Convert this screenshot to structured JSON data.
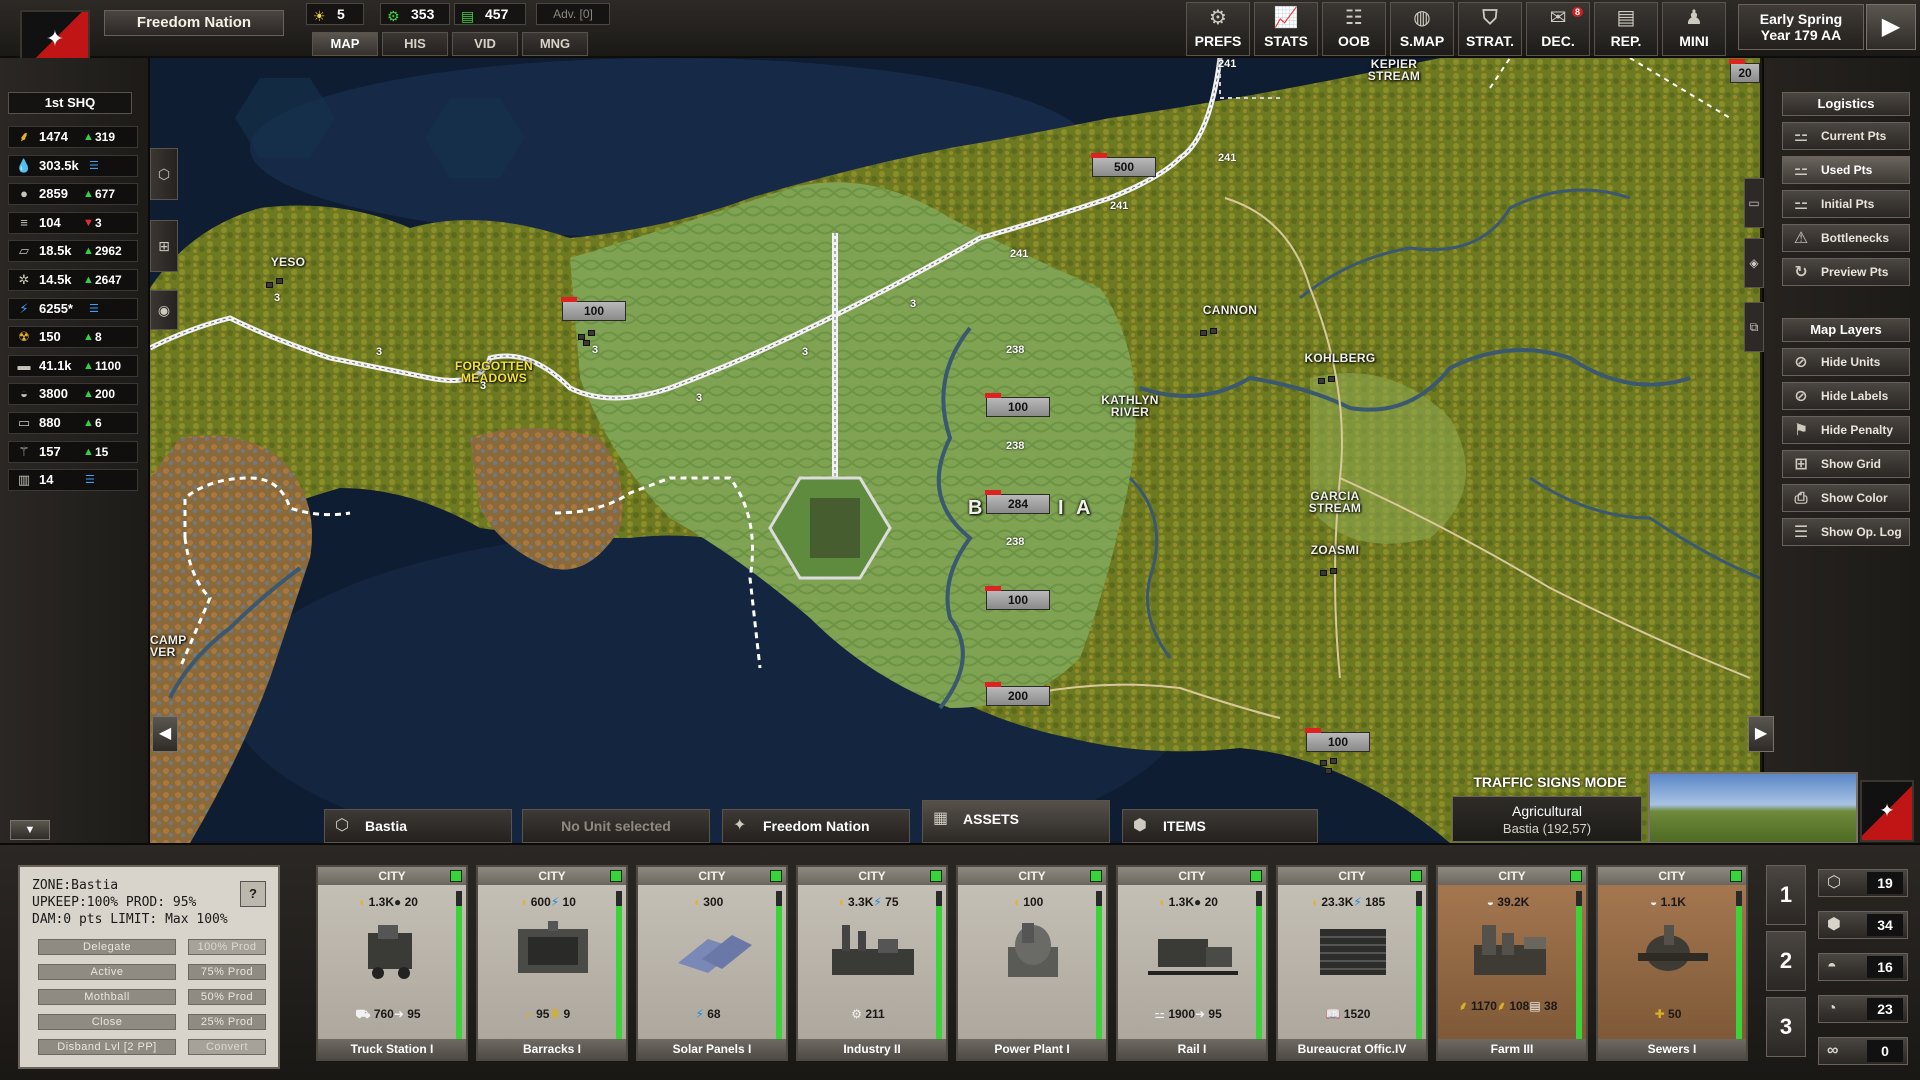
{
  "nation": {
    "name": "Freedom Nation",
    "emblem": "eagle-icon",
    "colors": [
      "#111111",
      "#c01515"
    ]
  },
  "top_resources": [
    {
      "icon": "sun-icon",
      "value": "5"
    },
    {
      "icon": "gear-coin-icon",
      "value": "353"
    },
    {
      "icon": "money-icon",
      "value": "457"
    }
  ],
  "adv": "Adv. [0]",
  "top_tabs": [
    "MAP",
    "HIS",
    "VID",
    "MNG"
  ],
  "menu": [
    {
      "label": "PREFS",
      "icon": "gear-icon"
    },
    {
      "label": "STATS",
      "icon": "chart-icon"
    },
    {
      "label": "OOB",
      "icon": "hierarchy-icon"
    },
    {
      "label": "S.MAP",
      "icon": "globe-icon"
    },
    {
      "label": "STRAT.",
      "icon": "shield-icon"
    },
    {
      "label": "DEC.",
      "icon": "mail-icon",
      "badge": "8"
    },
    {
      "label": "REP.",
      "icon": "report-icon"
    },
    {
      "label": "MINI",
      "icon": "person-icon"
    }
  ],
  "date": {
    "line1": "Early Spring",
    "line2": "Year 179 AA"
  },
  "hq": "1st SHQ",
  "resources": [
    {
      "icon": "food-icon",
      "value": "1474",
      "trend": "up",
      "delta": "319"
    },
    {
      "icon": "water-icon",
      "value": "303.5k",
      "trend": "eq",
      "delta": ""
    },
    {
      "icon": "oil-icon",
      "value": "2859",
      "trend": "up",
      "delta": "677"
    },
    {
      "icon": "fuel-icon",
      "value": "104",
      "trend": "down",
      "delta": "3"
    },
    {
      "icon": "metal-icon",
      "value": "18.5k",
      "trend": "up",
      "delta": "2962"
    },
    {
      "icon": "parts-icon",
      "value": "14.5k",
      "trend": "up",
      "delta": "2647"
    },
    {
      "icon": "energy-icon",
      "value": "6255*",
      "trend": "eq",
      "delta": ""
    },
    {
      "icon": "radiation-icon",
      "value": "150",
      "trend": "up",
      "delta": "8"
    },
    {
      "icon": "ammo-icon",
      "value": "41.1k",
      "trend": "up",
      "delta": "1100"
    },
    {
      "icon": "bread-icon",
      "value": "3800",
      "trend": "up",
      "delta": "200"
    },
    {
      "icon": "crate-icon",
      "value": "880",
      "trend": "up",
      "delta": "6"
    },
    {
      "icon": "medic-icon",
      "value": "157",
      "trend": "up",
      "delta": "15"
    },
    {
      "icon": "building-icon",
      "value": "14",
      "trend": "eq",
      "delta": ""
    }
  ],
  "map": {
    "labels": [
      {
        "text": "YESO",
        "color": "white"
      },
      {
        "text": "FORGOTTEN\nMEADOWS",
        "color": "yellow"
      },
      {
        "text": "CANNON",
        "color": "white"
      },
      {
        "text": "KOHLBERG",
        "color": "white"
      },
      {
        "text": "KATHLYN\nRIVER",
        "color": "white"
      },
      {
        "text": "GARCIA\nSTREAM",
        "color": "white"
      },
      {
        "text": "ZOASMI",
        "color": "white"
      },
      {
        "text": "KEPIER\nSTREAM",
        "color": "white"
      },
      {
        "text": "CAMP\nVER",
        "color": "white"
      }
    ],
    "value_tags": [
      "500",
      "100",
      "100",
      "284",
      "100",
      "200",
      "100",
      "20"
    ],
    "rail_numbers": [
      "241",
      "241",
      "241",
      "241",
      "238",
      "238",
      "238",
      "3",
      "3",
      "3",
      "3",
      "3",
      "3",
      "3"
    ],
    "city_letters": [
      "B",
      "I",
      "A"
    ]
  },
  "logistics": {
    "title": "Logistics",
    "buttons": [
      {
        "label": "Current Pts",
        "icon": "rail-icon",
        "active": false
      },
      {
        "label": "Used Pts",
        "icon": "rail-icon",
        "active": true
      },
      {
        "label": "Initial Pts",
        "icon": "rail-icon",
        "active": false
      },
      {
        "label": "Bottlenecks",
        "icon": "bottleneck-icon",
        "active": false
      },
      {
        "label": "Preview Pts",
        "icon": "refresh-icon",
        "active": false
      }
    ]
  },
  "map_layers": {
    "title": "Map Layers",
    "buttons": [
      {
        "label": "Hide Units",
        "icon": "slash-icon"
      },
      {
        "label": "Hide Labels",
        "icon": "slash-icon"
      },
      {
        "label": "Hide Penalty",
        "icon": "penalty-icon"
      },
      {
        "label": "Show Grid",
        "icon": "grid-icon"
      },
      {
        "label": "Show Color",
        "icon": "bookmark-icon"
      },
      {
        "label": "Show Op. Log",
        "icon": "log-icon"
      }
    ]
  },
  "bottom_tabs": [
    {
      "label": "Bastia",
      "icon": "hex-icon",
      "dim": false
    },
    {
      "label": "No Unit selected",
      "icon": "",
      "dim": true
    },
    {
      "label": "Freedom Nation",
      "icon": "eagle-icon",
      "dim": false
    },
    {
      "label": "ASSETS",
      "icon": "factory-icon",
      "dim": false
    },
    {
      "label": "ITEMS",
      "icon": "cube-icon",
      "dim": false
    }
  ],
  "traffic_mode": "TRAFFIC SIGNS MODE",
  "zone_info": {
    "type": "Agricultural",
    "location": "Bastia (192,57)"
  },
  "zone_card": {
    "zone": "ZONE:Bastia",
    "upkeep": "UPKEEP:100%",
    "prod": "PROD: 95%",
    "dam": "DAM:0 pts",
    "limit": "LIMIT: Max 100%",
    "help": "?",
    "buttons_left": [
      "Delegate",
      "Active",
      "Mothball",
      "Close",
      "Disband Lvl [2 PP]"
    ],
    "buttons_right": [
      "100% Prod",
      "75% Prod",
      "50% Prod",
      "25% Prod",
      "Convert"
    ]
  },
  "assets": [
    {
      "tag": "CITY",
      "name": "Truck Station I",
      "top": [
        {
          "ic": "coin-icon",
          "v": "1.3K"
        },
        {
          "ic": "oil-icon",
          "v": "20"
        }
      ],
      "bottom": [
        {
          "ic": "truck-icon",
          "v": "760"
        },
        {
          "ic": "arrow-icon",
          "v": "95"
        }
      ],
      "fill": 0.9
    },
    {
      "tag": "CITY",
      "name": "Barracks I",
      "top": [
        {
          "ic": "coin-icon",
          "v": "600"
        },
        {
          "ic": "energy-icon",
          "v": "10"
        }
      ],
      "bottom": [
        {
          "ic": "rifle-icon",
          "v": "95"
        },
        {
          "ic": "soldier-icon",
          "v": "9"
        }
      ],
      "fill": 0.9
    },
    {
      "tag": "CITY",
      "name": "Solar Panels I",
      "top": [
        {
          "ic": "coin-icon",
          "v": "300"
        }
      ],
      "bottom": [
        {
          "ic": "energy-icon",
          "v": "68"
        }
      ],
      "fill": 0.9
    },
    {
      "tag": "CITY",
      "name": "Industry II",
      "top": [
        {
          "ic": "coin-icon",
          "v": "3.3K"
        },
        {
          "ic": "energy-icon",
          "v": "75"
        }
      ],
      "bottom": [
        {
          "ic": "gear-icon",
          "v": "211"
        }
      ],
      "fill": 0.9
    },
    {
      "tag": "CITY",
      "name": "Power Plant I",
      "top": [
        {
          "ic": "coin-icon",
          "v": "100"
        }
      ],
      "bottom": [],
      "fill": 0.9
    },
    {
      "tag": "CITY",
      "name": "Rail I",
      "top": [
        {
          "ic": "coin-icon",
          "v": "1.3K"
        },
        {
          "ic": "oil-icon",
          "v": "20"
        }
      ],
      "bottom": [
        {
          "ic": "rail-icon",
          "v": "1900"
        },
        {
          "ic": "arrow-icon",
          "v": "95"
        }
      ],
      "fill": 0.9
    },
    {
      "tag": "CITY",
      "name": "Bureaucrat Offic.IV",
      "top": [
        {
          "ic": "coin-icon",
          "v": "23.3K"
        },
        {
          "ic": "energy-icon",
          "v": "185"
        }
      ],
      "bottom": [
        {
          "ic": "book-icon",
          "v": "1520"
        }
      ],
      "fill": 0.9
    },
    {
      "tag": "CITY",
      "name": "Farm III",
      "top": [
        {
          "ic": "bread-icon",
          "v": "39.2K"
        }
      ],
      "bottom": [
        {
          "ic": "wheat-icon",
          "v": "1170"
        },
        {
          "ic": "grain-icon",
          "v": "108"
        },
        {
          "ic": "money-icon",
          "v": "38"
        }
      ],
      "fill": 0.9
    },
    {
      "tag": "CITY",
      "name": "Sewers I",
      "top": [
        {
          "ic": "bread-icon",
          "v": "1.1K"
        }
      ],
      "bottom": [
        {
          "ic": "health-icon",
          "v": "50"
        }
      ],
      "fill": 0.9
    }
  ],
  "pager": [
    "1",
    "2",
    "3"
  ],
  "counters": [
    {
      "icon": "hex-icon",
      "value": "19"
    },
    {
      "icon": "multi-hex-icon",
      "value": "34"
    },
    {
      "icon": "helmet-icon",
      "value": "16"
    },
    {
      "icon": "helmet2-icon",
      "value": "23"
    },
    {
      "icon": "link-icon",
      "value": "0"
    }
  ]
}
